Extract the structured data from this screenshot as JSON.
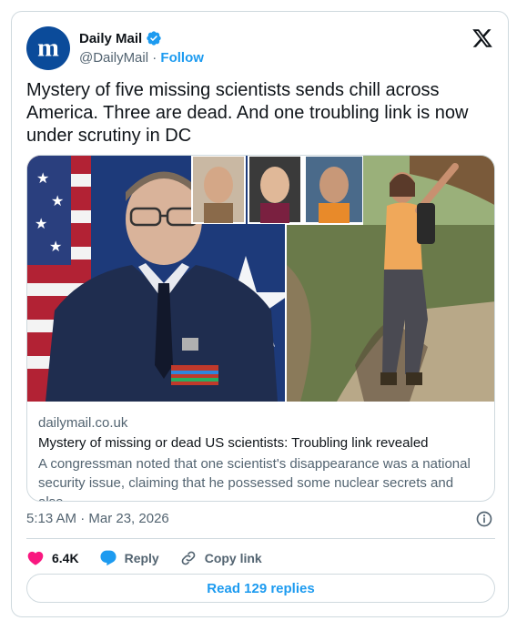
{
  "author": {
    "display_name": "Daily Mail",
    "handle": "@DailyMail",
    "separator": " · ",
    "follow_label": "Follow",
    "avatar_letter": "m"
  },
  "tweet": {
    "text": "Mystery of five missing scientists sends chill across America. Three are dead. And one troubling link is now under scrutiny in DC"
  },
  "link_card": {
    "domain": "dailymail.co.uk",
    "title": "Mystery of missing or dead US scientists: Troubling link revealed",
    "description": "A congressman noted that one scientist's disappearance was a national security issue, claiming that he possessed some nuclear secrets and also..."
  },
  "timestamp": "5:13 AM · Mar 23, 2026",
  "actions": {
    "like_count": "6.4K",
    "reply_label": "Reply",
    "copy_label": "Copy link"
  },
  "read_replies_label": "Read 129 replies",
  "colors": {
    "accent": "#1d9bf0",
    "like": "#f91880",
    "avatar_bg": "#0b4b9a",
    "muted": "#536471",
    "border": "#cfd9de"
  },
  "icons": [
    "verified-badge-icon",
    "x-logo-icon",
    "info-icon",
    "heart-icon",
    "reply-bubble-icon",
    "link-icon"
  ]
}
